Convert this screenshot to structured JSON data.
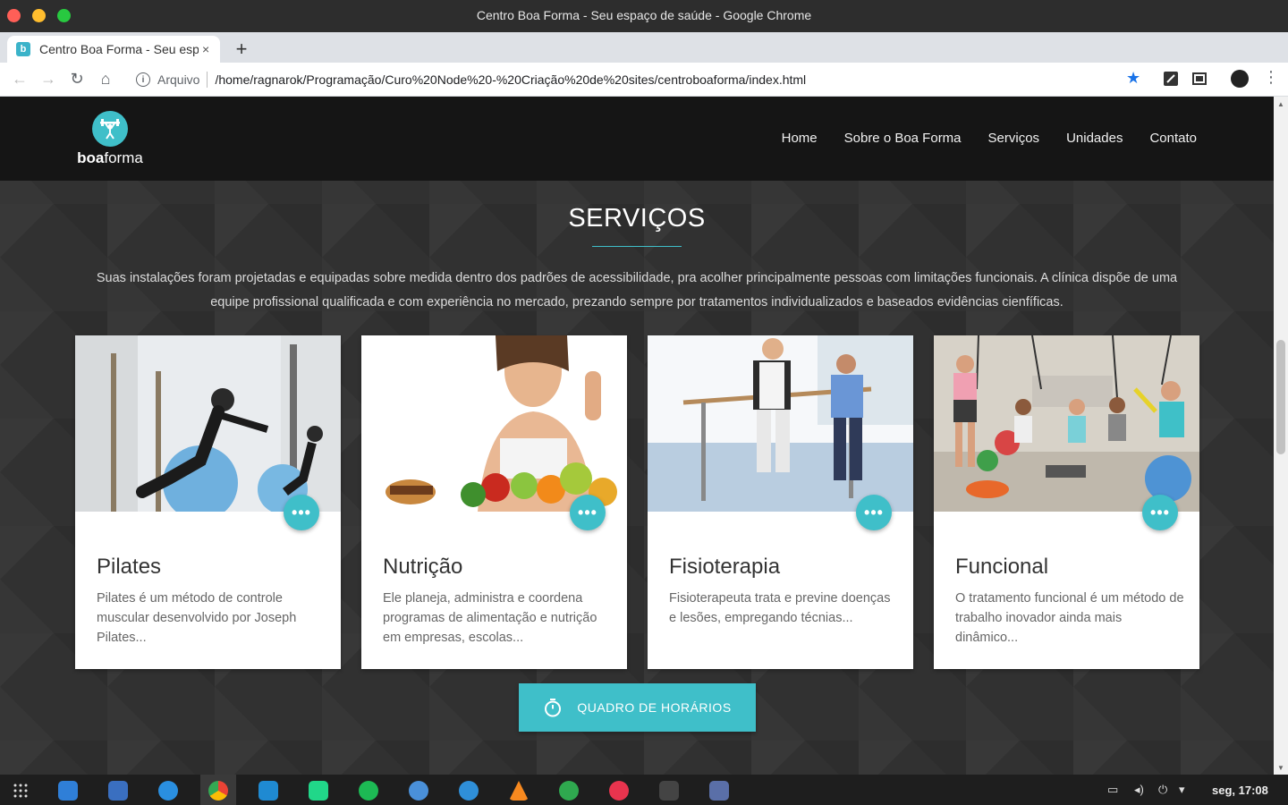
{
  "window": {
    "title": "Centro Boa Forma - Seu espaço de saúde - Google Chrome"
  },
  "browser": {
    "tab_title": "Centro Boa Forma - Seu espaço de saúde",
    "tab_close": "×",
    "new_tab": "+",
    "info_label": "Arquivo",
    "url": "/home/ragnarok/Programação/Curo%20Node%20-%20Criação%20de%20sites/centroboaforma/index.html"
  },
  "site": {
    "logo": {
      "bold": "boa",
      "regular": "forma"
    },
    "nav": [
      "Home",
      "Sobre o Boa Forma",
      "Serviços",
      "Unidades",
      "Contato"
    ],
    "section_title": "SERVIÇOS",
    "intro": "Suas instalações foram projetadas e equipadas sobre medida dentro dos padrões de acessibilidade, pra acolher principalmente pessoas com limitações funcionais. A clínica dispõe de uma equipe profissional qualificada e com experiência no mercado, prezando sempre por tratamentos individualizados e baseados evidências cienfíficas.",
    "cards": [
      {
        "title": "Pilates",
        "text": "Pilates é um método de controle muscular desenvolvido por Joseph Pilates...",
        "image": "pilates-photo"
      },
      {
        "title": "Nutrição",
        "text": "Ele planeja, administra e coordena programas de alimentação e nutrição em empresas, escolas...",
        "image": "nutrition-photo"
      },
      {
        "title": "Fisioterapia",
        "text": "Fisioterapeuta trata e previne doenças e lesões, empregando técnias...",
        "image": "physio-photo"
      },
      {
        "title": "Funcional",
        "text": "O tratamento funcional é um método de trabalho inovador ainda mais dinâmico...",
        "image": "functional-photo"
      }
    ],
    "fab_label": "•••",
    "schedule_button": "QUADRO DE HORÁRIOS"
  },
  "taskbar": {
    "clock": "seg, 17:08"
  },
  "colors": {
    "accent": "#3fbfc9",
    "nav_bg": "#151515",
    "page_bg": "#313131"
  }
}
